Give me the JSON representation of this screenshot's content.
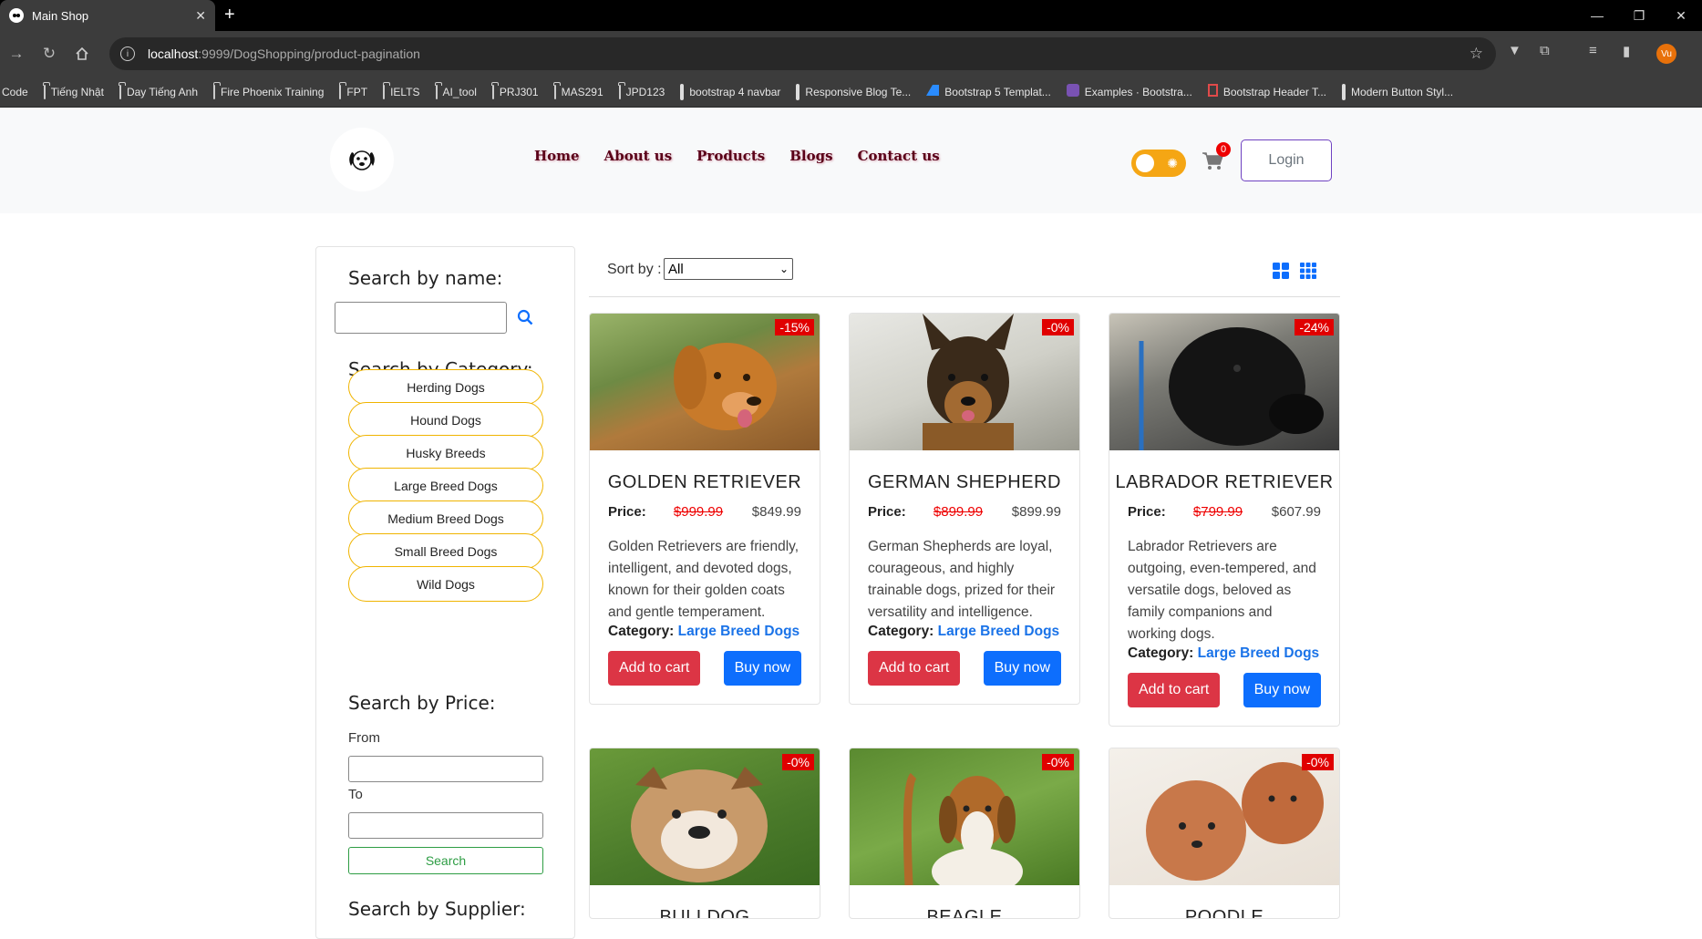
{
  "browser": {
    "tab_title": "Main Shop",
    "url_host": "localhost",
    "url_rest": ":9999/DogShopping/product-pagination",
    "profile_initials": "Vu",
    "bookmarks": [
      {
        "label": "Code",
        "icon": "none"
      },
      {
        "label": "Tiếng Nhật",
        "icon": "folder-icon"
      },
      {
        "label": "Day Tiếng Anh",
        "icon": "folder-icon"
      },
      {
        "label": "Fire Phoenix Training",
        "icon": "folder-icon"
      },
      {
        "label": "FPT",
        "icon": "folder-icon"
      },
      {
        "label": "IELTS",
        "icon": "folder-icon"
      },
      {
        "label": "AI_tool",
        "icon": "folder-icon"
      },
      {
        "label": "PRJ301",
        "icon": "folder-icon"
      },
      {
        "label": "MAS291",
        "icon": "folder-icon"
      },
      {
        "label": "JPD123",
        "icon": "folder-icon"
      },
      {
        "label": "bootstrap 4 navbar",
        "icon": "codepen-icon"
      },
      {
        "label": "Responsive Blog Te...",
        "icon": "codepen-icon"
      },
      {
        "label": "Bootstrap 5 Templat...",
        "icon": "arrow-logo-icon"
      },
      {
        "label": "Examples · Bootstra...",
        "icon": "bootstrap-icon"
      },
      {
        "label": "Bootstrap Header T...",
        "icon": "page-icon"
      },
      {
        "label": "Modern Button Styl...",
        "icon": "codepen-icon"
      }
    ]
  },
  "header": {
    "nav": [
      "Home",
      "About us",
      "Products",
      "Blogs",
      "Contact us"
    ],
    "cart_count": "0",
    "login_label": "Login"
  },
  "sidebar": {
    "search_name_title": "Search by name:",
    "search_name_value": "",
    "category_title": "Search by Category:",
    "categories": [
      "Herding Dogs",
      "Hound Dogs",
      "Husky Breeds",
      "Large Breed Dogs",
      "Medium Breed Dogs",
      "Small Breed Dogs",
      "Wild Dogs"
    ],
    "price_title": "Search by Price:",
    "from_label": "From",
    "to_label": "To",
    "from_value": "",
    "to_value": "",
    "search_button": "Search",
    "supplier_title": "Search by Supplier:"
  },
  "sort": {
    "label": "Sort by :",
    "selected": "All"
  },
  "labels": {
    "price": "Price:",
    "category": "Category:",
    "add_to_cart": "Add to cart",
    "buy_now": "Buy now"
  },
  "products": [
    {
      "name": "GOLDEN RETRIEVER",
      "discount": "-15%",
      "old_price": "$999.99",
      "price": "$849.99",
      "description": "Golden Retrievers are friendly, intelligent, and devoted dogs, known for their golden coats and gentle temperament.",
      "category": "Large Breed Dogs",
      "image": "golden-retriever-photo"
    },
    {
      "name": "GERMAN SHEPHERD",
      "discount": "-0%",
      "old_price": "$899.99",
      "price": "$899.99",
      "description": "German Shepherds are loyal, courageous, and highly trainable dogs, prized for their versatility and intelligence.",
      "category": "Large Breed Dogs",
      "image": "german-shepherd-photo"
    },
    {
      "name": "LABRADOR RETRIEVER",
      "discount": "-24%",
      "old_price": "$799.99",
      "price": "$607.99",
      "description": "Labrador Retrievers are outgoing, even-tempered, and versatile dogs, beloved as family companions and working dogs.",
      "category": "Large Breed Dogs",
      "image": "labrador-photo"
    },
    {
      "name": "BULLDOG",
      "discount": "-0%",
      "image": "bulldog-photo"
    },
    {
      "name": "BEAGLE",
      "discount": "-0%",
      "image": "beagle-photo"
    },
    {
      "name": "POODLE",
      "discount": "-0%",
      "image": "poodle-photo"
    }
  ],
  "colors": {
    "badge_red": "#e00000",
    "add_to_cart": "#dc3545",
    "buy_now": "#0d6efd",
    "category_border": "#f0b400",
    "nav_text": "#5a0018",
    "toggle": "#f5a614"
  }
}
